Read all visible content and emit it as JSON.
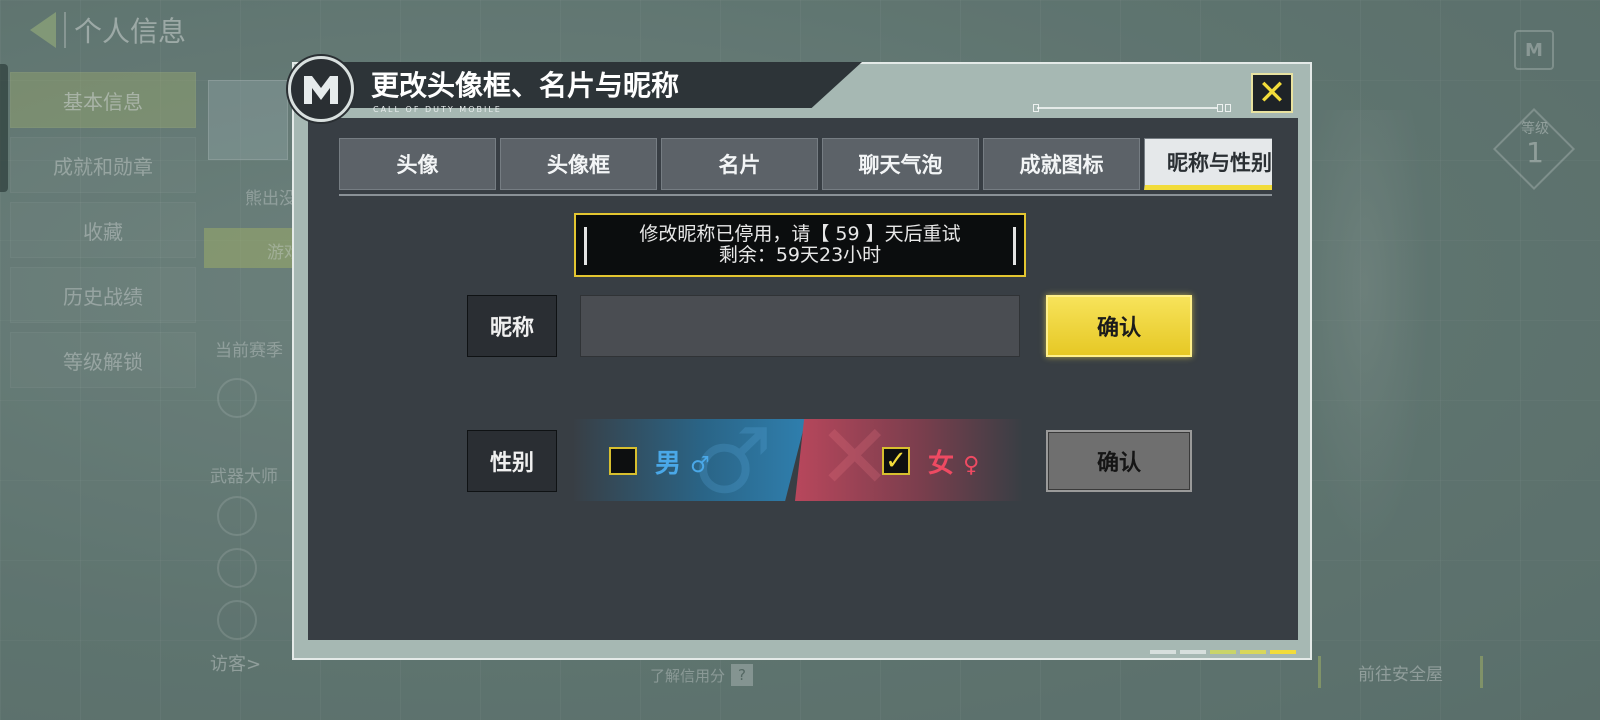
{
  "background": {
    "back_title": "个人信息",
    "side_tabs": [
      "基本信息",
      "成就和勋章",
      "收藏",
      "历史战绩",
      "等级解锁"
    ],
    "rows": [
      "熊出没",
      "游戏",
      "当前赛季",
      "武器大师"
    ],
    "visitor": "访客>",
    "credit": "了解信用分",
    "credit_icon": "?",
    "safehouse": "前往安全屋",
    "level_label": "等级",
    "level_value": "1"
  },
  "dialog": {
    "title": "更改头像框、名片与昵称",
    "subtitle": "CALL OF DUTY MOBILE",
    "close_icon": "close-x-icon",
    "tabs": [
      {
        "label": "头像",
        "active": false
      },
      {
        "label": "头像框",
        "active": false
      },
      {
        "label": "名片",
        "active": false
      },
      {
        "label": "聊天气泡",
        "active": false
      },
      {
        "label": "成就图标",
        "active": false
      },
      {
        "label": "昵称与性别",
        "active": true
      }
    ],
    "notice": {
      "line1": "修改昵称已停用，请【 59 】天后重试",
      "line2": "剩余：59天23小时"
    },
    "nickname": {
      "label": "昵称",
      "value": "",
      "placeholder": "",
      "confirm": "确认"
    },
    "gender": {
      "label": "性别",
      "male": "男",
      "male_symbol": "♂",
      "female": "女",
      "female_symbol": "♀",
      "male_checked": false,
      "female_checked": true,
      "confirm": "确认"
    }
  },
  "colors": {
    "accent": "#f2dc3a",
    "male": "#2f7fae",
    "female": "#d8495d",
    "panel": "#383e44"
  }
}
